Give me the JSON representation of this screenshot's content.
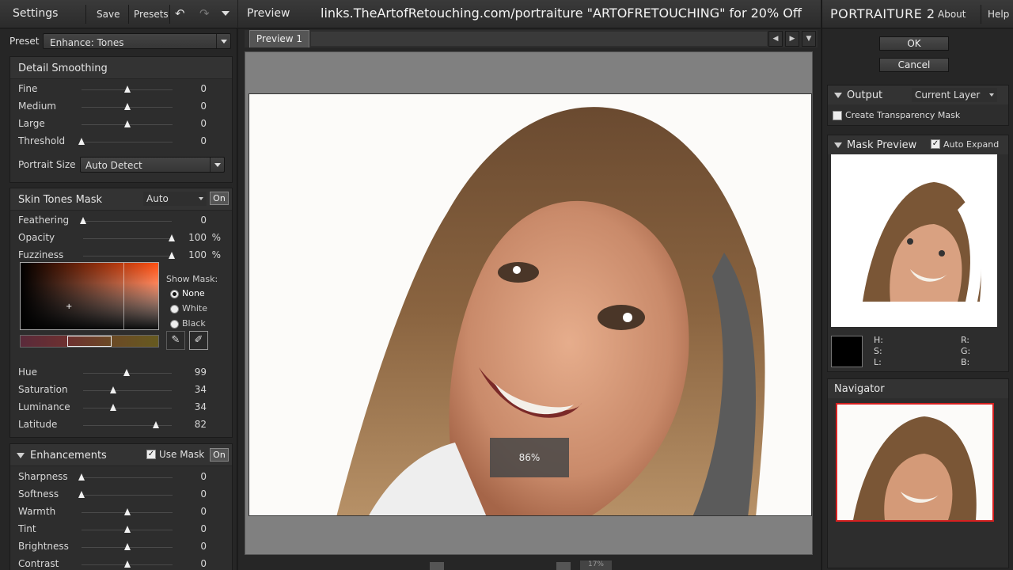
{
  "left": {
    "title": "Settings",
    "save_label": "Save",
    "presets_label": "Presets",
    "preset_label": "Preset",
    "preset_value": "Enhance: Tones",
    "detail_smoothing": {
      "title": "Detail Smoothing",
      "rows": [
        {
          "name": "Fine",
          "value": "0",
          "pos": 0.5
        },
        {
          "name": "Medium",
          "value": "0",
          "pos": 0.5
        },
        {
          "name": "Large",
          "value": "0",
          "pos": 0.5
        },
        {
          "name": "Threshold",
          "value": "0",
          "pos": 0.0
        }
      ],
      "portrait_size_label": "Portrait Size",
      "portrait_size_value": "Auto Detect"
    },
    "skin_tones_mask": {
      "title": "Skin Tones Mask",
      "mode": "Auto",
      "on_label": "On",
      "rows": [
        {
          "name": "Feathering",
          "value": "0",
          "unit": "",
          "pos": 0.0
        },
        {
          "name": "Opacity",
          "value": "100",
          "unit": "%",
          "pos": 1.0
        },
        {
          "name": "Fuzziness",
          "value": "100",
          "unit": "%",
          "pos": 1.0
        }
      ],
      "show_mask_label": "Show Mask:",
      "show_mask_options": [
        "None",
        "White",
        "Black"
      ],
      "show_mask_selected": "None",
      "hsl_rows": [
        {
          "name": "Hue",
          "value": "99",
          "pos": 0.49
        },
        {
          "name": "Saturation",
          "value": "34",
          "pos": 0.34
        },
        {
          "name": "Luminance",
          "value": "34",
          "pos": 0.34
        },
        {
          "name": "Latitude",
          "value": "82",
          "pos": 0.82
        }
      ]
    },
    "enhancements": {
      "title": "Enhancements",
      "use_mask_label": "Use Mask",
      "on_label": "On",
      "rows": [
        {
          "name": "Sharpness",
          "value": "0",
          "pos": 0.0
        },
        {
          "name": "Softness",
          "value": "0",
          "pos": 0.0
        },
        {
          "name": "Warmth",
          "value": "0",
          "pos": 0.5
        },
        {
          "name": "Tint",
          "value": "0",
          "pos": 0.5
        },
        {
          "name": "Brightness",
          "value": "0",
          "pos": 0.5
        },
        {
          "name": "Contrast",
          "value": "0",
          "pos": 0.5
        }
      ]
    }
  },
  "center": {
    "title": "Preview",
    "promo": "links.TheArtofRetouching.com/portraiture  \"ARTOFRETOUCHING\" for 20% Off",
    "tab_label": "Preview 1",
    "zoom_label": "86%",
    "bottom_zoom": "17%"
  },
  "right": {
    "brand": "PORTRAITURE 2",
    "about_label": "About",
    "help_label": "Help",
    "ok_label": "OK",
    "cancel_label": "Cancel",
    "output_title": "Output",
    "output_value": "Current Layer",
    "transparency_label": "Create Transparency Mask",
    "mask_preview_title": "Mask Preview",
    "auto_expand_label": "Auto Expand",
    "hsl_labels": {
      "h": "H:",
      "s": "S:",
      "l": "L:",
      "r": "R:",
      "g": "G:",
      "b": "B:"
    },
    "navigator_title": "Navigator"
  },
  "colors": {
    "panel": "#262626",
    "canvas": "#808080",
    "nav_frame": "#d52020",
    "accent_orange": "#ff4e10"
  }
}
